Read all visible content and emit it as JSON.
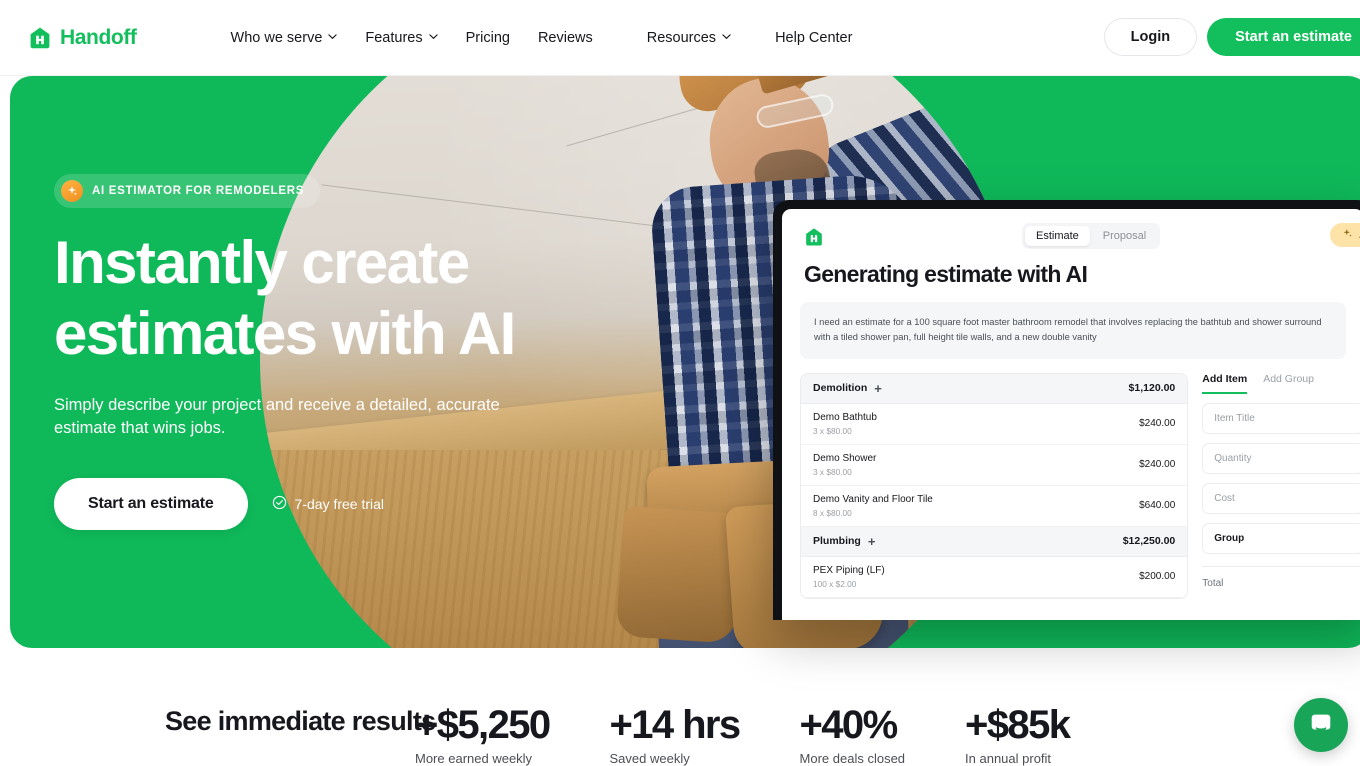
{
  "brand": {
    "name": "Handoff",
    "green": "#13bf5d",
    "amber": "#fcd89a"
  },
  "nav": {
    "links": [
      {
        "label": "Who we serve",
        "caret": true
      },
      {
        "label": "Features",
        "caret": true
      },
      {
        "label": "Pricing",
        "caret": false
      },
      {
        "label": "Reviews",
        "caret": false
      },
      {
        "label": "Resources",
        "caret": true
      },
      {
        "label": "Help Center",
        "caret": false
      }
    ],
    "login_label": "Login",
    "cta_label": "Start an estimate"
  },
  "hero": {
    "badge": "AI ESTIMATOR FOR REMODELERS",
    "heading_line1": "Instantly create",
    "heading_line2": "estimates with AI",
    "subheading": "Simply describe your project and receive a detailed, accurate estimate that wins jobs.",
    "cta_label": "Start an estimate",
    "trial_note": "7-day free trial"
  },
  "app": {
    "tabs": [
      {
        "label": "Estimate",
        "active": true
      },
      {
        "label": "Proposal",
        "active": false
      }
    ],
    "ai_pill": "AI",
    "title": "Generating estimate with AI",
    "prompt": "I need an estimate for a 100 square foot master bathroom remodel that involves replacing the bathtub and shower surround with a tiled shower pan, full height tile walls, and a new double vanity",
    "estimate": [
      {
        "type": "group",
        "name": "Demolition",
        "amount": "$1,120.00"
      },
      {
        "type": "item",
        "name": "Demo Bathtub",
        "detail": "3 x $80.00",
        "amount": "$240.00"
      },
      {
        "type": "item",
        "name": "Demo Shower",
        "detail": "3 x $80.00",
        "amount": "$240.00"
      },
      {
        "type": "item",
        "name": "Demo Vanity and Floor Tile",
        "detail": "8 x $80.00",
        "amount": "$640.00"
      },
      {
        "type": "group",
        "name": "Plumbing",
        "amount": "$12,250.00"
      },
      {
        "type": "item",
        "name": "PEX Piping (LF)",
        "detail": "100 x $2.00",
        "amount": "$200.00"
      }
    ],
    "add_panel": {
      "tabs": [
        {
          "label": "Add Item",
          "active": true
        },
        {
          "label": "Add Group",
          "active": false
        }
      ],
      "fields": [
        {
          "label": "Item Title",
          "filled": false
        },
        {
          "label": "Quantity",
          "filled": false
        },
        {
          "label": "Cost",
          "filled": false
        },
        {
          "label": "Group",
          "filled": true
        }
      ],
      "total_label": "Total"
    }
  },
  "results": {
    "title": "See immediate results",
    "stats": [
      {
        "value": "+$5,250",
        "label": "More earned weekly"
      },
      {
        "value": "+14 hrs",
        "label": "Saved weekly"
      },
      {
        "value": "+40%",
        "label": "More deals closed"
      },
      {
        "value": "+$85k",
        "label": "In annual profit"
      }
    ]
  },
  "chat": {
    "name": "chat-widget"
  }
}
